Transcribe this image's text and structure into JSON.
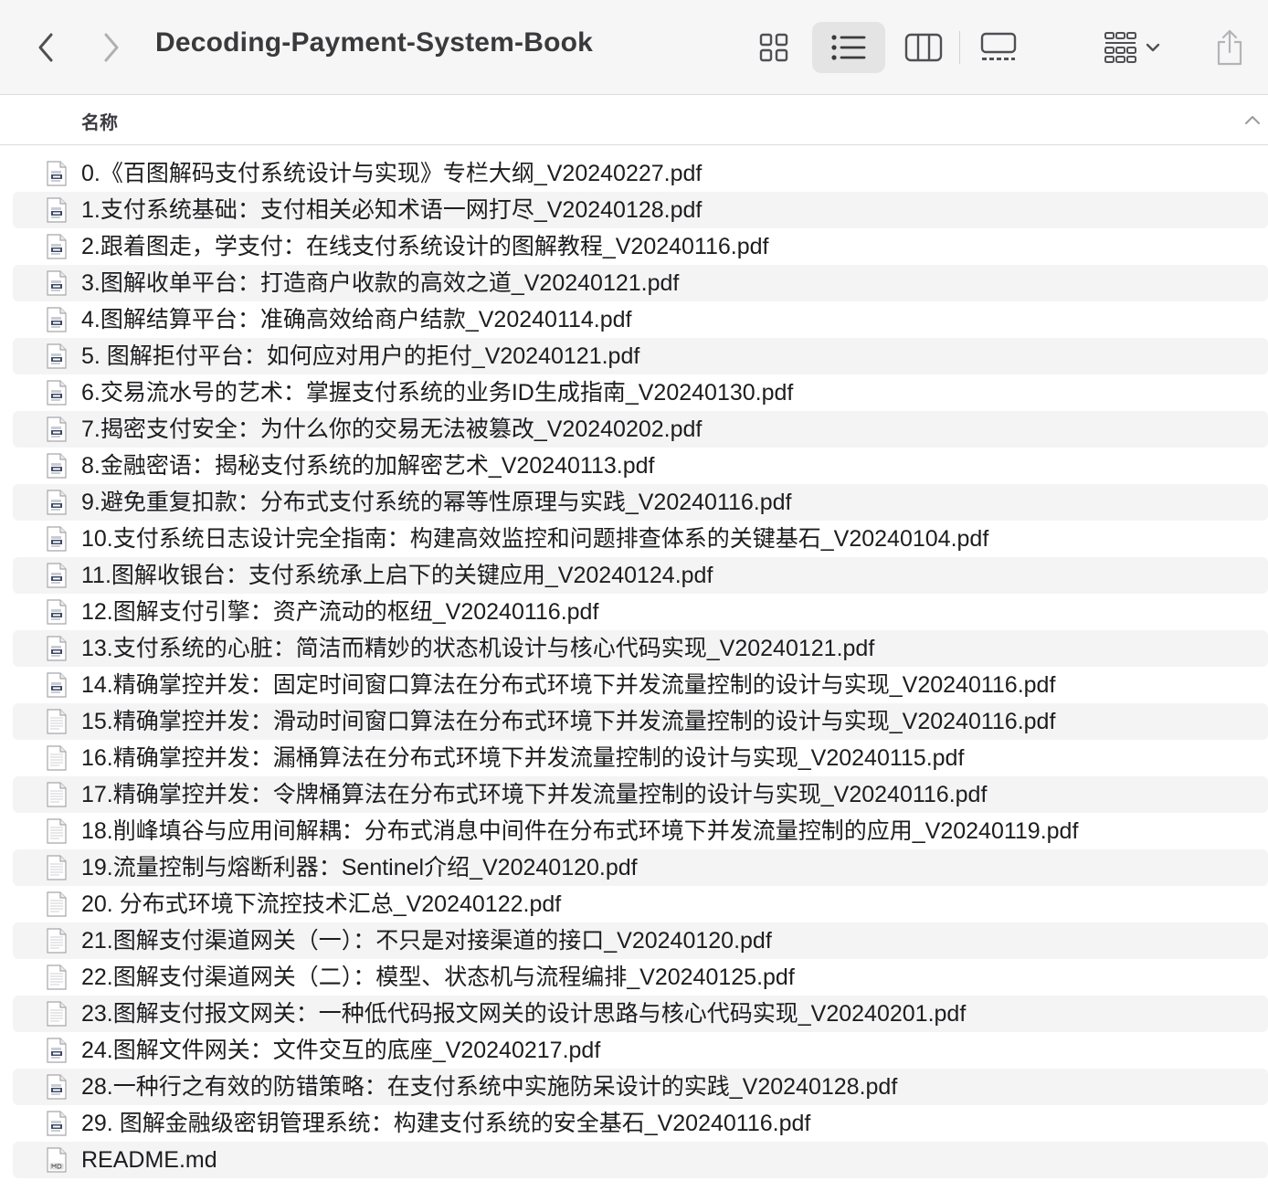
{
  "window": {
    "title": "Decoding-Payment-System-Book"
  },
  "toolbar": {
    "back_icon": "chevron-left-icon",
    "forward_icon": "chevron-right-icon",
    "view_modes": [
      "icons",
      "list",
      "columns",
      "gallery"
    ],
    "active_view": "list",
    "group_icon": "group-by-icon",
    "share_icon": "share-icon"
  },
  "header": {
    "name_column": "名称",
    "sort_icon": "chevron-up-icon"
  },
  "colors": {
    "toolbar_bg": "#f6f6f6",
    "stripe": "#f4f4f5",
    "text": "#1d1d1f"
  },
  "files": [
    {
      "name": "0.《百图解码支付系统设计与实现》专栏大纲_V20240227.pdf",
      "icon": "pdf-file-icon"
    },
    {
      "name": "1.支付系统基础：支付相关必知术语一网打尽_V20240128.pdf",
      "icon": "pdf-file-icon"
    },
    {
      "name": "2.跟着图走，学支付：在线支付系统设计的图解教程_V20240116.pdf",
      "icon": "pdf-file-icon"
    },
    {
      "name": "3.图解收单平台：打造商户收款的高效之道_V20240121.pdf",
      "icon": "pdf-file-icon"
    },
    {
      "name": "4.图解结算平台：准确高效给商户结款_V20240114.pdf",
      "icon": "pdf-file-icon"
    },
    {
      "name": "5. 图解拒付平台：如何应对用户的拒付_V20240121.pdf",
      "icon": "pdf-file-icon"
    },
    {
      "name": "6.交易流水号的艺术：掌握支付系统的业务ID生成指南_V20240130.pdf",
      "icon": "pdf-file-icon"
    },
    {
      "name": "7.揭密支付安全：为什么你的交易无法被篡改_V20240202.pdf",
      "icon": "pdf-file-icon"
    },
    {
      "name": "8.金融密语：揭秘支付系统的加解密艺术_V20240113.pdf",
      "icon": "pdf-file-icon"
    },
    {
      "name": "9.避免重复扣款：分布式支付系统的幂等性原理与实践_V20240116.pdf",
      "icon": "pdf-file-icon"
    },
    {
      "name": "10.支付系统日志设计完全指南：构建高效监控和问题排查体系的关键基石_V20240104.pdf",
      "icon": "pdf-file-icon"
    },
    {
      "name": "11.图解收银台：支付系统承上启下的关键应用_V20240124.pdf",
      "icon": "pdf-file-icon"
    },
    {
      "name": "12.图解支付引擎：资产流动的枢纽_V20240116.pdf",
      "icon": "pdf-file-icon"
    },
    {
      "name": "13.支付系统的心脏：简洁而精妙的状态机设计与核心代码实现_V20240121.pdf",
      "icon": "pdf-file-icon"
    },
    {
      "name": "14.精确掌控并发：固定时间窗口算法在分布式环境下并发流量控制的设计与实现_V20240116.pdf",
      "icon": "pdf-file-icon"
    },
    {
      "name": "15.精确掌控并发：滑动时间窗口算法在分布式环境下并发流量控制的设计与实现_V20240116.pdf",
      "icon": "text-file-icon"
    },
    {
      "name": "16.精确掌控并发：漏桶算法在分布式环境下并发流量控制的设计与实现_V20240115.pdf",
      "icon": "text-file-icon"
    },
    {
      "name": "17.精确掌控并发：令牌桶算法在分布式环境下并发流量控制的设计与实现_V20240116.pdf",
      "icon": "text-file-icon"
    },
    {
      "name": "18.削峰填谷与应用间解耦：分布式消息中间件在分布式环境下并发流量控制的应用_V20240119.pdf",
      "icon": "text-file-icon"
    },
    {
      "name": "19.流量控制与熔断利器：Sentinel介绍_V20240120.pdf",
      "icon": "text-file-icon"
    },
    {
      "name": "20. 分布式环境下流控技术汇总_V20240122.pdf",
      "icon": "text-file-icon"
    },
    {
      "name": "21.图解支付渠道网关（一）：不只是对接渠道的接口_V20240120.pdf",
      "icon": "text-file-icon"
    },
    {
      "name": "22.图解支付渠道网关（二）：模型、状态机与流程编排_V20240125.pdf",
      "icon": "text-file-icon"
    },
    {
      "name": "23.图解支付报文网关：一种低代码报文网关的设计思路与核心代码实现_V20240201.pdf",
      "icon": "text-file-icon"
    },
    {
      "name": "24.图解文件网关：文件交互的底座_V20240217.pdf",
      "icon": "pdf-file-icon"
    },
    {
      "name": "28.一种行之有效的防错策略：在支付系统中实施防呆设计的实践_V20240128.pdf",
      "icon": "pdf-file-icon"
    },
    {
      "name": "29. 图解金融级密钥管理系统：构建支付系统的安全基石_V20240116.pdf",
      "icon": "pdf-file-icon"
    },
    {
      "name": "README.md",
      "icon": "markdown-file-icon"
    }
  ]
}
